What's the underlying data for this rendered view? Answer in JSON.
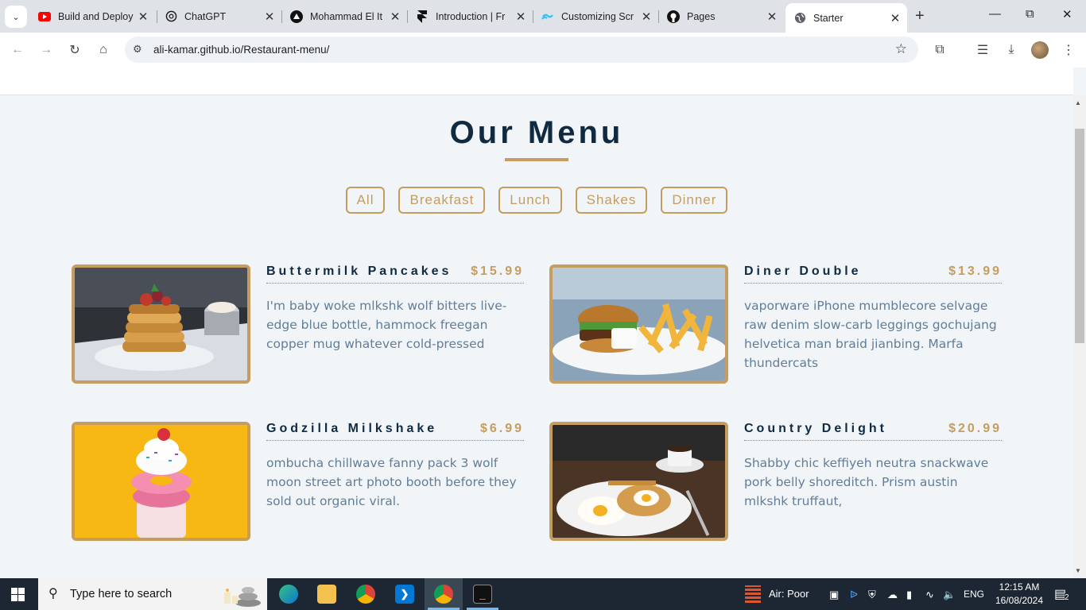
{
  "tabs": [
    {
      "title": "Build and Deploy",
      "icon": "youtube-icon"
    },
    {
      "title": "ChatGPT",
      "icon": "chatgpt-icon"
    },
    {
      "title": "Mohammad El It",
      "icon": "vercel-icon"
    },
    {
      "title": "Introduction | Fr",
      "icon": "framer-icon"
    },
    {
      "title": "Customizing Scr",
      "icon": "tailwind-icon"
    },
    {
      "title": "Pages",
      "icon": "github-icon"
    },
    {
      "title": "Starter",
      "icon": "globe-icon"
    }
  ],
  "address_bar": {
    "url": "ali-kamar.github.io/Restaurant-menu/"
  },
  "page": {
    "title": "Our Menu",
    "filters": [
      "All",
      "Breakfast",
      "Lunch",
      "Shakes",
      "Dinner"
    ],
    "items": [
      {
        "name": "Buttermilk Pancakes",
        "price": "$15.99",
        "desc": "I'm baby woke mlkshk wolf bitters live-edge blue bottle, hammock freegan copper mug whatever cold-pressed",
        "image": "pancakes-image"
      },
      {
        "name": "Diner Double",
        "price": "$13.99",
        "desc": "vaporware iPhone mumblecore selvage raw denim slow-carb leggings gochujang helvetica man braid jianbing. Marfa thundercats",
        "image": "burger-image"
      },
      {
        "name": "Godzilla Milkshake",
        "price": "$6.99",
        "desc": "ombucha chillwave fanny pack 3 wolf moon street art photo booth before they sold out organic viral.",
        "image": "milkshake-image"
      },
      {
        "name": "Country Delight",
        "price": "$20.99",
        "desc": "Shabby chic keffiyeh neutra snackwave pork belly shoreditch. Prism austin mlkshk truffaut,",
        "image": "eggs-image"
      }
    ],
    "colors": {
      "accent": "#c59d5f",
      "heading": "#102a42",
      "text": "#617d98",
      "background": "#f1f5f8"
    }
  },
  "taskbar": {
    "search_placeholder": "Type here to search",
    "weather": "Air: Poor",
    "language": "ENG",
    "time": "12:15 AM",
    "date": "16/08/2024",
    "notifications": "2"
  }
}
